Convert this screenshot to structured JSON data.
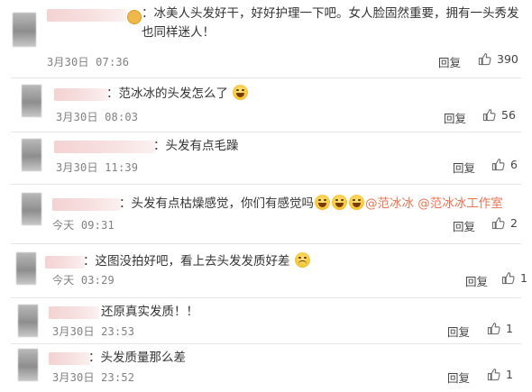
{
  "comments": [
    {
      "text": "：冰美人头发好干，好好护理一下吧。女人脸固然重要，拥有一头秀发也同样迷人！",
      "time": "3月30日 07:36",
      "reply": "回复",
      "likes": "390"
    },
    {
      "text": "：范冰冰的头发怎么了",
      "time": "3月30日 08:03",
      "reply": "回复",
      "likes": "56"
    },
    {
      "text": "：头发有点毛躁",
      "time": "3月30日 11:39",
      "reply": "回复",
      "likes": "6"
    },
    {
      "text": "：头发有点枯燥感觉，你们有感觉吗",
      "mention1": "@范冰冰",
      "mention2": "@范冰冰工作室",
      "time": "今天 09:31",
      "reply": "回复",
      "likes": "2"
    },
    {
      "text": "：这图没拍好吧，看上去头发发质好差",
      "time": "今天 03:29",
      "reply": "回复",
      "likes": "1"
    },
    {
      "text": "还原真实发质！！",
      "time": "3月30日 23:53",
      "reply": "回复",
      "likes": "1"
    },
    {
      "text": "：头发质量那么差",
      "time": "3月30日 23:52",
      "reply": "回复",
      "likes": "1"
    }
  ],
  "icons": {
    "like": "thumbs-up-icon",
    "emoji_laugh": "laughing-emoji-icon",
    "emoji_sad": "sad-emoji-icon",
    "vip": "vip-badge-icon"
  },
  "colors": {
    "mention": "#eb7350",
    "meta": "#808080"
  }
}
